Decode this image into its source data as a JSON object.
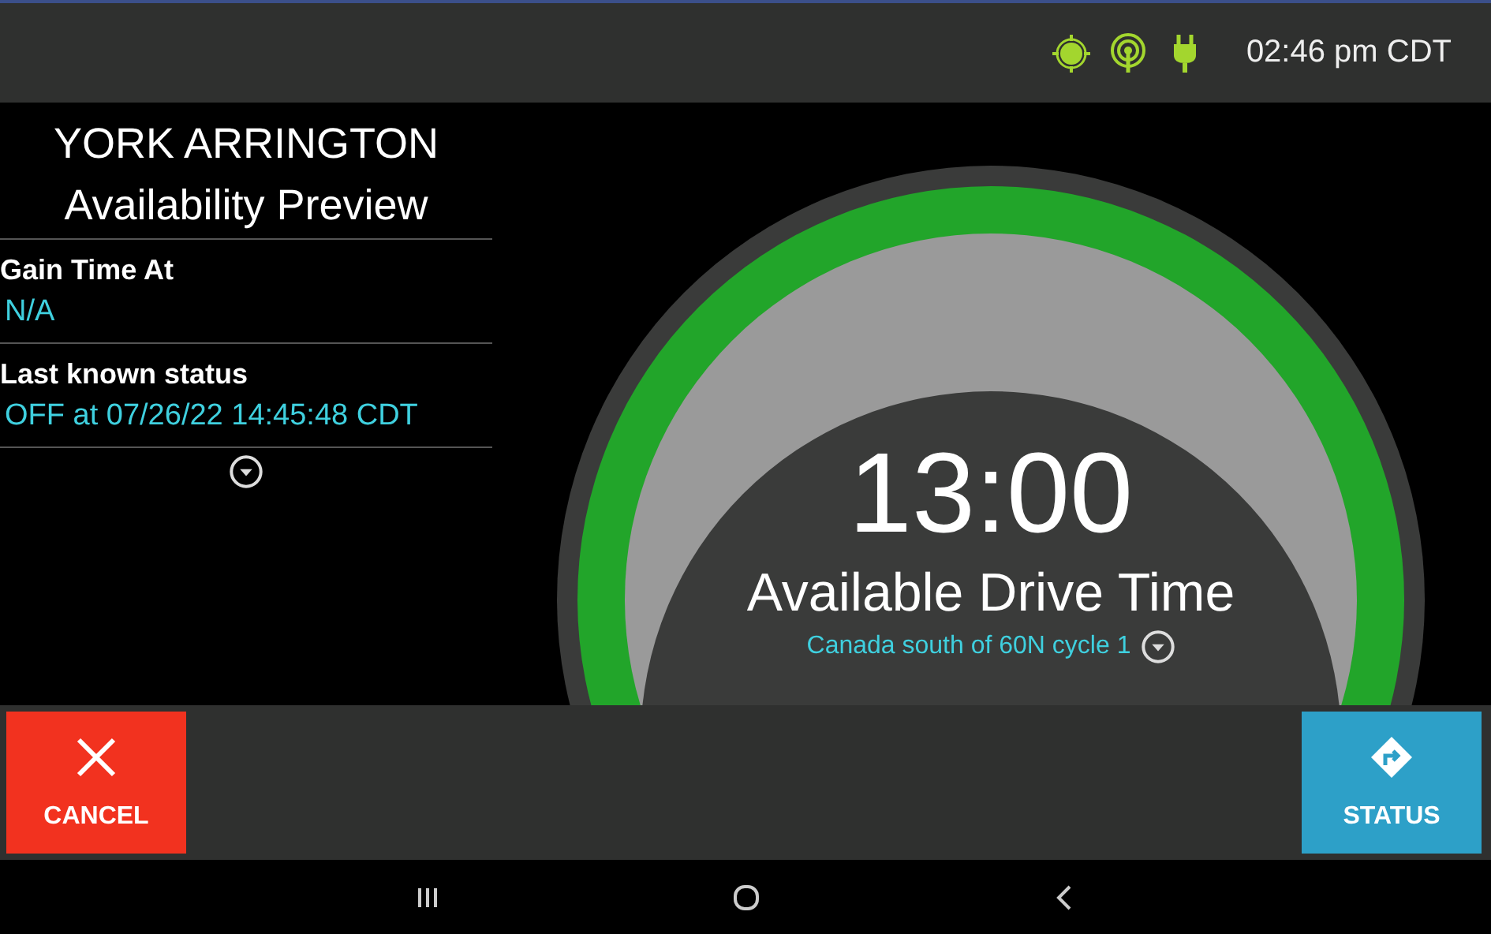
{
  "status_bar": {
    "time": "02:46 pm CDT"
  },
  "driver": {
    "name": "YORK ARRINGTON",
    "title": "Availability Preview"
  },
  "fields": [
    {
      "label": "Gain Time At",
      "value": "N/A"
    },
    {
      "label": "Last known status",
      "value": "OFF at 07/26/22 14:45:48 CDT"
    }
  ],
  "gauge": {
    "time": "13:00",
    "label": "Available Drive Time",
    "cycle": "Canada south of 60N cycle 1"
  },
  "buttons": [
    {
      "kind": "cancel",
      "label": "CANCEL"
    },
    {
      "kind": "status",
      "label": "STATUS"
    }
  ]
}
